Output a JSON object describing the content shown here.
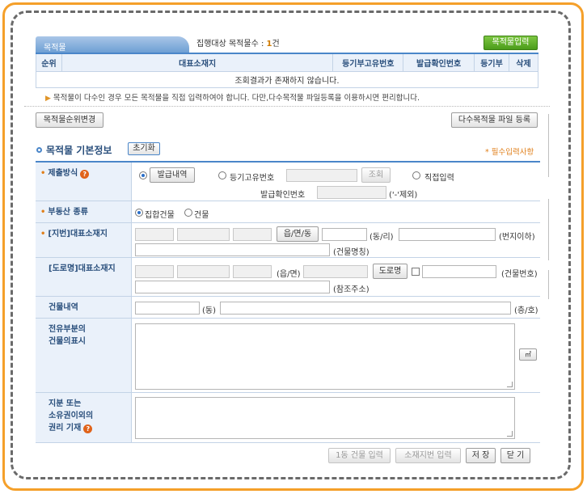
{
  "header": {
    "tab_label": "목적물",
    "count_label": "집행대상 목적물수 :",
    "count_value": "1",
    "count_unit": "건",
    "input_button": "목적물입력"
  },
  "table": {
    "columns": [
      "순위",
      "대표소재지",
      "등기부고유번호",
      "발급확인번호",
      "등기부",
      "삭제"
    ],
    "empty_message": "조회결과가 존재하지 않습니다."
  },
  "note": "목적물이 다수인 경우 모든 목적물을 직접 입력하여야 합니다. 다만,다수목적물 파일등록을 이용하시면 편리합니다.",
  "buttons": {
    "reorder": "목적물순위변경",
    "multi_file": "다수목적물 파일 등록",
    "reset": "초기화",
    "issue_detail": "발급내역",
    "lookup": "조회",
    "eup_myeon_dong": "읍/면/동",
    "road_name": "도로명",
    "sqm": "㎡",
    "single_building": "1동 건물 입력",
    "lot_input": "소재지번 입력",
    "save": "저 장",
    "close": "닫 기"
  },
  "section": {
    "title": "목적물 기본정보",
    "required_note": "* 필수입력사항"
  },
  "form": {
    "submit_method": {
      "label": "제출방식",
      "options": [
        "등기고유번호",
        "직접입력"
      ],
      "issue_no_label": "발급확인번호",
      "issue_no_hint": "('-'제외)"
    },
    "property_type": {
      "label": "부동산 종류",
      "options": [
        "집합건물",
        "건물"
      ]
    },
    "lot_address": {
      "label": "[지번]대표소재지",
      "dong_ri": "(동/리)",
      "lot_below": "(번지이하)",
      "building_name": "(건물명칭)"
    },
    "road_address": {
      "label": "[도로명]대표소재지",
      "eup_myeon": "(읍/면)",
      "building_no": "(건물번호)",
      "ref_address": "(참조주소)"
    },
    "building_detail": {
      "label": "건물내역",
      "dong": "(동)",
      "floor_ho": "(층/호)"
    },
    "exclusive_part": {
      "label_line1": "전유부분의",
      "label_line2": "건물의표시"
    },
    "other_rights": {
      "label_line1": "지분 또는",
      "label_line2": "소유권이외의",
      "label_line3": "권리 기재"
    }
  },
  "colors": {
    "frame_orange": "#f5a02a",
    "accent_blue": "#4a86c9",
    "button_green": "#4b9c1a",
    "required_orange": "#e07f1a"
  }
}
